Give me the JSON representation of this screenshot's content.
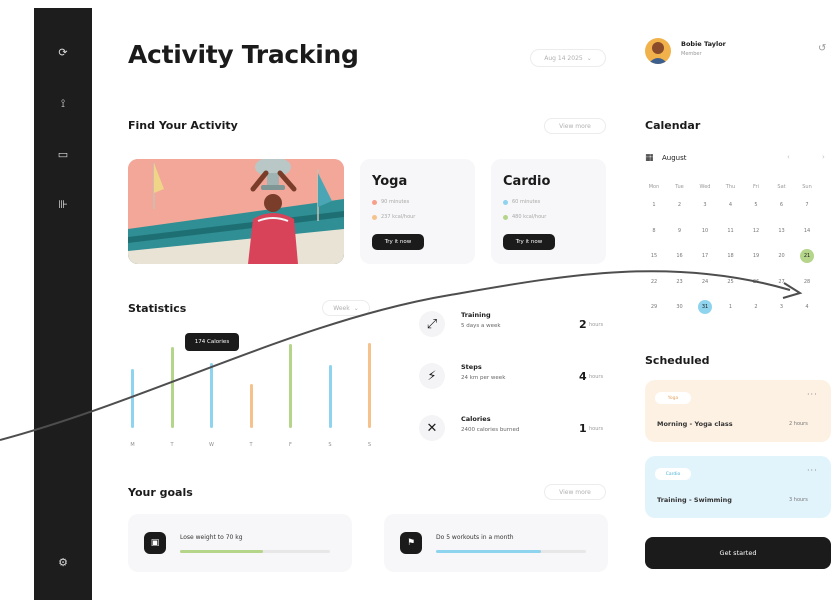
{
  "colors": {
    "dark": "#1d1d1d",
    "green": "#b5d58a",
    "blue": "#8fd4ee",
    "orange": "#f6c28c",
    "peach": "#fdf1e3",
    "sky": "#e2f4fb"
  },
  "sidebar": {
    "icons": [
      "refresh-icon",
      "activity-icon",
      "calendar-icon",
      "chart-icon"
    ],
    "bottom_icon": "settings-icon"
  },
  "header": {
    "title": "Activity Tracking",
    "period": "Aug 14 2025",
    "period_icon": "chevron-down-icon"
  },
  "find_activity": {
    "title": "Find Your Activity",
    "view_more": "View more",
    "cards": [
      {
        "title": "Yoga",
        "meta1": "90 minutes",
        "meta2": "237 kcal/hour",
        "button": "Try it now",
        "dot1": "#f6a08c",
        "dot2": "#f6c28c"
      },
      {
        "title": "Cardio",
        "meta1": "60 minutes",
        "meta2": "480 kcal/hour",
        "button": "Try it now",
        "dot1": "#8fd4ee",
        "dot2": "#b5d58a"
      }
    ]
  },
  "statistics": {
    "title": "Statistics",
    "period": "Week",
    "tooltip": "174 Calories",
    "rows": [
      {
        "name": "Training",
        "sub": "5 days a week",
        "value": "2",
        "unit": "hours",
        "icon": "dumbbell-icon"
      },
      {
        "name": "Steps",
        "sub": "24 km per week",
        "value": "4",
        "unit": "hours",
        "icon": "run-icon"
      },
      {
        "name": "Calories",
        "sub": "2400 calories burned",
        "value": "1",
        "unit": "hours",
        "icon": "fork-icon"
      }
    ]
  },
  "chart_data": {
    "type": "bar",
    "categories": [
      "M",
      "T",
      "W",
      "T",
      "F",
      "S",
      "S"
    ],
    "series": [
      {
        "values": [
          62,
          85,
          68,
          46,
          88,
          66,
          90
        ],
        "colors": [
          "#8fd4ee",
          "#b5d58a",
          "#8fd4ee",
          "#f6c28c",
          "#b5d58a",
          "#8fd4ee",
          "#f6c28c"
        ]
      }
    ],
    "ylim": [
      0,
      100
    ],
    "highlight_index": 2
  },
  "goals": {
    "title": "Your goals",
    "view_more": "View more",
    "items": [
      {
        "label": "Lose weight to 70 kg",
        "progress": 0.55,
        "color": "#b5d58a",
        "icon": "scale-icon"
      },
      {
        "label": "Do 5 workouts in a month",
        "progress": 0.7,
        "color": "#8fd4ee",
        "icon": "workout-icon"
      }
    ]
  },
  "profile": {
    "name": "Bobie Taylor",
    "role": "Member",
    "icon": "notification-icon"
  },
  "calendar": {
    "title": "Calendar",
    "month": "August",
    "weekdays": [
      "Mon",
      "Tue",
      "Wed",
      "Thu",
      "Fri",
      "Sat",
      "Sun"
    ],
    "weeks": [
      [
        "1",
        "2",
        "3",
        "4",
        "5",
        "6",
        "7"
      ],
      [
        "8",
        "9",
        "10",
        "11",
        "12",
        "13",
        "14"
      ],
      [
        "15",
        "16",
        "17",
        "18",
        "19",
        "20",
        "21"
      ],
      [
        "22",
        "23",
        "24",
        "25",
        "26",
        "27",
        "28"
      ],
      [
        "29",
        "30",
        "31",
        "1",
        "2",
        "3",
        "4"
      ]
    ],
    "highlight_green": "21",
    "highlight_blue": "31"
  },
  "scheduled": {
    "title": "Scheduled",
    "items": [
      {
        "tag": "Yoga",
        "name": "Morning - Yoga class",
        "time": "2 hours",
        "bg": "#fdf1e3",
        "tag_color": "#e8a361"
      },
      {
        "tag": "Cardio",
        "name": "Training - Swimming",
        "time": "3 hours",
        "bg": "#e2f4fb",
        "tag_color": "#4cb3d6"
      }
    ],
    "button": "Get started"
  }
}
